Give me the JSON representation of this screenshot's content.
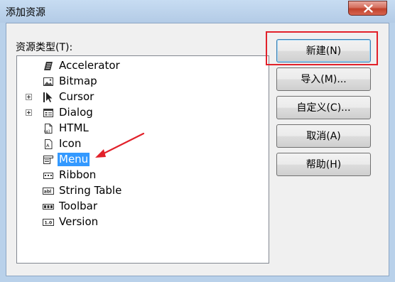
{
  "window": {
    "title": "添加资源"
  },
  "resource_types": {
    "label": "资源类型(T):",
    "items": [
      {
        "label": "Accelerator",
        "icon": "accelerator-icon",
        "expandable": false,
        "selected": false
      },
      {
        "label": "Bitmap",
        "icon": "bitmap-icon",
        "expandable": false,
        "selected": false
      },
      {
        "label": "Cursor",
        "icon": "cursor-icon",
        "expandable": true,
        "selected": false
      },
      {
        "label": "Dialog",
        "icon": "dialog-icon",
        "expandable": true,
        "selected": false
      },
      {
        "label": "HTML",
        "icon": "html-icon",
        "expandable": false,
        "selected": false
      },
      {
        "label": "Icon",
        "icon": "icon-resource-icon",
        "expandable": false,
        "selected": false
      },
      {
        "label": "Menu",
        "icon": "menu-icon",
        "expandable": false,
        "selected": true
      },
      {
        "label": "Ribbon",
        "icon": "ribbon-icon",
        "expandable": false,
        "selected": false
      },
      {
        "label": "String Table",
        "icon": "string-table-icon",
        "expandable": false,
        "selected": false
      },
      {
        "label": "Toolbar",
        "icon": "toolbar-icon",
        "expandable": false,
        "selected": false
      },
      {
        "label": "Version",
        "icon": "version-icon",
        "expandable": false,
        "selected": false
      }
    ]
  },
  "buttons": {
    "new": "新建(N)",
    "import": "导入(M)...",
    "custom": "自定义(C)...",
    "cancel": "取消(A)",
    "help": "帮助(H)"
  },
  "annotation_color": "#e2212a",
  "selection_color": "#3399ff"
}
